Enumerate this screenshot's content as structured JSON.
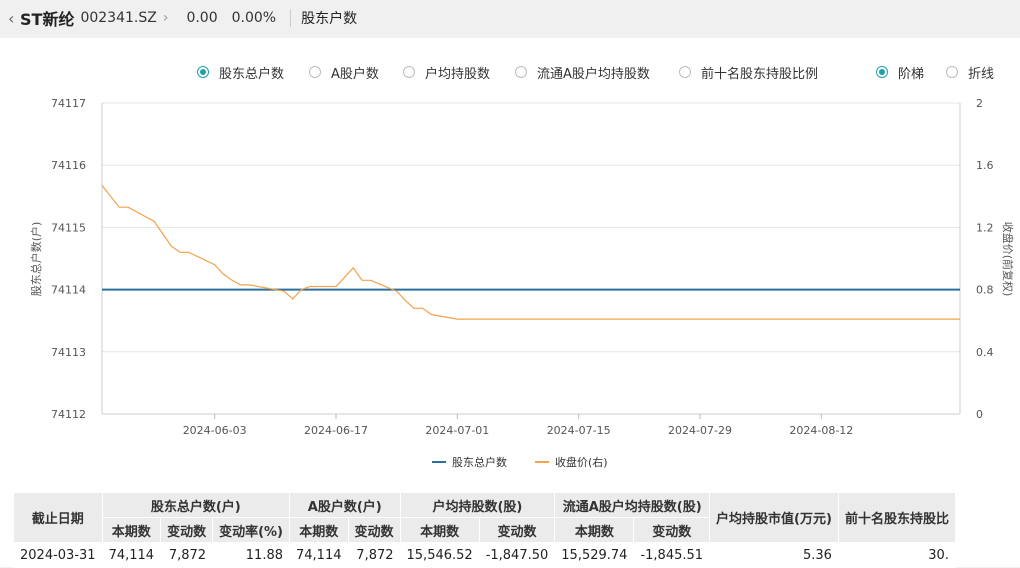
{
  "header": {
    "back_icon": "chevron-left-icon",
    "stock_name": "ST新纶",
    "stock_code": "002341.SZ",
    "next_icon": "chevron-right-icon",
    "price": "0.00",
    "change_pct": "0.00%",
    "page_title": "股东户数"
  },
  "options": {
    "metrics": [
      {
        "label": "股东总户数",
        "selected": true
      },
      {
        "label": "A股户数",
        "selected": false
      },
      {
        "label": "户均持股数",
        "selected": false
      },
      {
        "label": "流通A股户均持股数",
        "selected": false
      },
      {
        "label": "前十名股东持股比例",
        "selected": false
      }
    ],
    "styles": [
      {
        "label": "阶梯",
        "selected": true
      },
      {
        "label": "折线",
        "selected": false
      }
    ]
  },
  "colors": {
    "accent": "#1f9fa8",
    "series_holders": "#2b6f9e",
    "series_price": "#f5a04a"
  },
  "chart_data": {
    "type": "line",
    "ylabel_left": "股东总户数(户)",
    "ylabel_right": "收盘价(前复权)",
    "yticks_left": [
      "74117",
      "74116",
      "74115",
      "74114",
      "74113",
      "74112"
    ],
    "yticks_right": [
      "2",
      "1.6",
      "1.2",
      "0.8",
      "0.4",
      "0"
    ],
    "ylim_left": [
      74112,
      74117
    ],
    "ylim_right": [
      0,
      2
    ],
    "xlim": [
      "2024-05-21",
      "2024-08-28"
    ],
    "xticks": [
      "2024-06-03",
      "2024-06-17",
      "2024-07-01",
      "2024-07-15",
      "2024-07-29",
      "2024-08-12"
    ],
    "legend_position": "bottom",
    "series": [
      {
        "name": "股东总户数",
        "axis": "left",
        "x": [
          "2024-05-21",
          "2024-08-28"
        ],
        "values": [
          74114,
          74114
        ]
      },
      {
        "name": "收盘价(右)",
        "axis": "right",
        "x": [
          "2024-05-21",
          "2024-05-23",
          "2024-05-24",
          "2024-05-27",
          "2024-05-28",
          "2024-05-29",
          "2024-05-30",
          "2024-05-31",
          "2024-06-03",
          "2024-06-04",
          "2024-06-05",
          "2024-06-06",
          "2024-06-07",
          "2024-06-11",
          "2024-06-12",
          "2024-06-13",
          "2024-06-14",
          "2024-06-17",
          "2024-06-18",
          "2024-06-19",
          "2024-06-20",
          "2024-06-21",
          "2024-06-24",
          "2024-06-25",
          "2024-06-26",
          "2024-06-27",
          "2024-06-28",
          "2024-07-01",
          "2024-07-02",
          "2024-07-03",
          "2024-08-28"
        ],
        "values": [
          1.47,
          1.33,
          1.33,
          1.24,
          1.16,
          1.08,
          1.04,
          1.04,
          0.96,
          0.9,
          0.86,
          0.83,
          0.83,
          0.79,
          0.74,
          0.8,
          0.82,
          0.82,
          0.88,
          0.94,
          0.86,
          0.86,
          0.79,
          0.73,
          0.68,
          0.68,
          0.64,
          0.61,
          0.61,
          0.61,
          0.61
        ]
      }
    ]
  },
  "table": {
    "header_row1": [
      {
        "label": "截止日期",
        "rowspan": 2,
        "colspan": 1
      },
      {
        "label": "股东总户数(户)",
        "rowspan": 1,
        "colspan": 3
      },
      {
        "label": "A股户数(户)",
        "rowspan": 1,
        "colspan": 2
      },
      {
        "label": "户均持股数(股)",
        "rowspan": 1,
        "colspan": 2
      },
      {
        "label": "流通A股户均持股数(股)",
        "rowspan": 1,
        "colspan": 2
      },
      {
        "label": "户均持股市值(万元)",
        "rowspan": 2,
        "colspan": 1
      },
      {
        "label": "前十名股东持股比",
        "rowspan": 2,
        "colspan": 1
      }
    ],
    "header_row2": [
      "本期数",
      "变动数",
      "变动率(%)",
      "本期数",
      "变动数",
      "本期数",
      "变动数",
      "本期数",
      "变动数"
    ],
    "rows": [
      [
        "2024-03-31",
        "74,114",
        "7,872",
        "11.88",
        "74,114",
        "7,872",
        "15,546.52",
        "-1,847.50",
        "15,529.74",
        "-1,845.51",
        "5.36",
        "30."
      ]
    ]
  }
}
